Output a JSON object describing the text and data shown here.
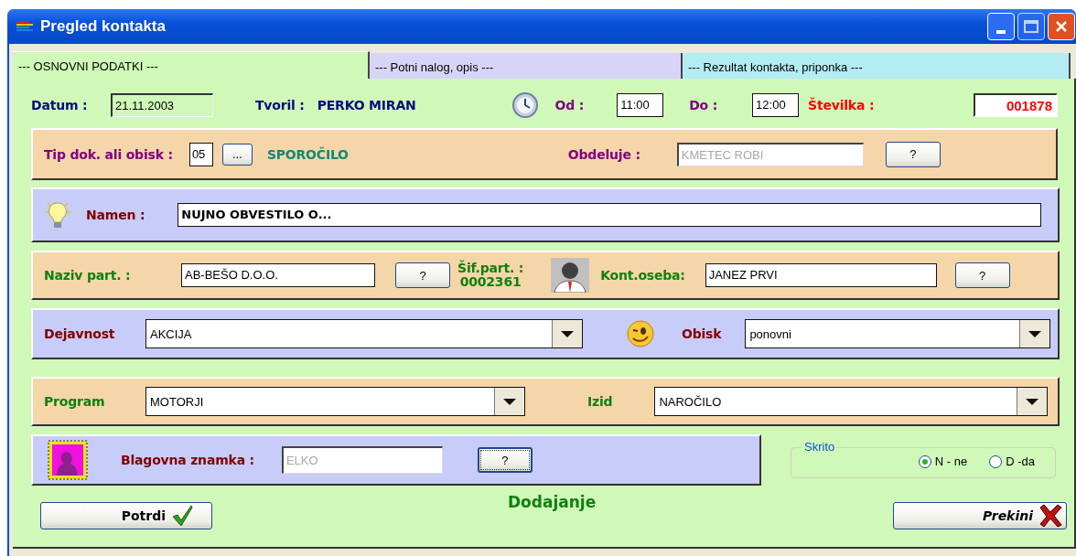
{
  "window": {
    "title": "Pregled kontakta"
  },
  "tabs": [
    {
      "label": "--- OSNOVNI PODATKI  ---",
      "selected": true,
      "color": "#d0f8b8"
    },
    {
      "label": "--- Potni nalog,  opis ---",
      "selected": false,
      "color": "#d8d4f8"
    },
    {
      "label": "--- Rezultat kontakta, priponka ---",
      "selected": false,
      "color": "#b4ecf4"
    }
  ],
  "header": {
    "date_label": "Datum :",
    "date": "21.11.2003",
    "creator_label": "Tvoril :",
    "creator": "PERKO MIRAN",
    "from_label": "Od :",
    "from": "11:00",
    "to_label": "Do :",
    "to": "12:00",
    "number_label": "Številka :",
    "number": "001878"
  },
  "document": {
    "type_label": "Tip dok. ali obisk :",
    "type_code": "05",
    "browse_button": "...",
    "type_name": "SPOROČILO",
    "handler_label": "Obdeluje :",
    "handler": "KMETEC ROBI",
    "handler_disabled": true,
    "handler_button": "?"
  },
  "purpose": {
    "label": "Namen :",
    "value": "NUJNO OBVESTILO O..."
  },
  "partner": {
    "label": "Naziv part. :",
    "value": "AB-BEŠO D.O.O.",
    "button": "?",
    "code_label": "Šif.part. :",
    "code": "0002361",
    "contact_label": "Kont.oseba:",
    "contact": "JANEZ PRVI",
    "contact_button": "?"
  },
  "activity": {
    "label": "Dejavnost",
    "value": "AKCIJA",
    "visit_label": "Obisk",
    "visit": "ponovni"
  },
  "program": {
    "label": "Program",
    "value": "MOTORJI",
    "outcome_label": "Izid",
    "outcome": "NAROČILO"
  },
  "brand": {
    "label": "Blagovna znamka :",
    "value": "ELKO",
    "disabled": true,
    "button": "?",
    "button_focused": true
  },
  "hidden": {
    "title": "Skrito",
    "options": [
      {
        "label": "N - ne",
        "selected": true
      },
      {
        "label": "D -da",
        "selected": false
      }
    ]
  },
  "mode": "Dodajanje",
  "buttons": [
    {
      "label": "Potrdi",
      "kind": "confirm"
    },
    {
      "label": "Prekini",
      "kind": "cancel"
    }
  ]
}
